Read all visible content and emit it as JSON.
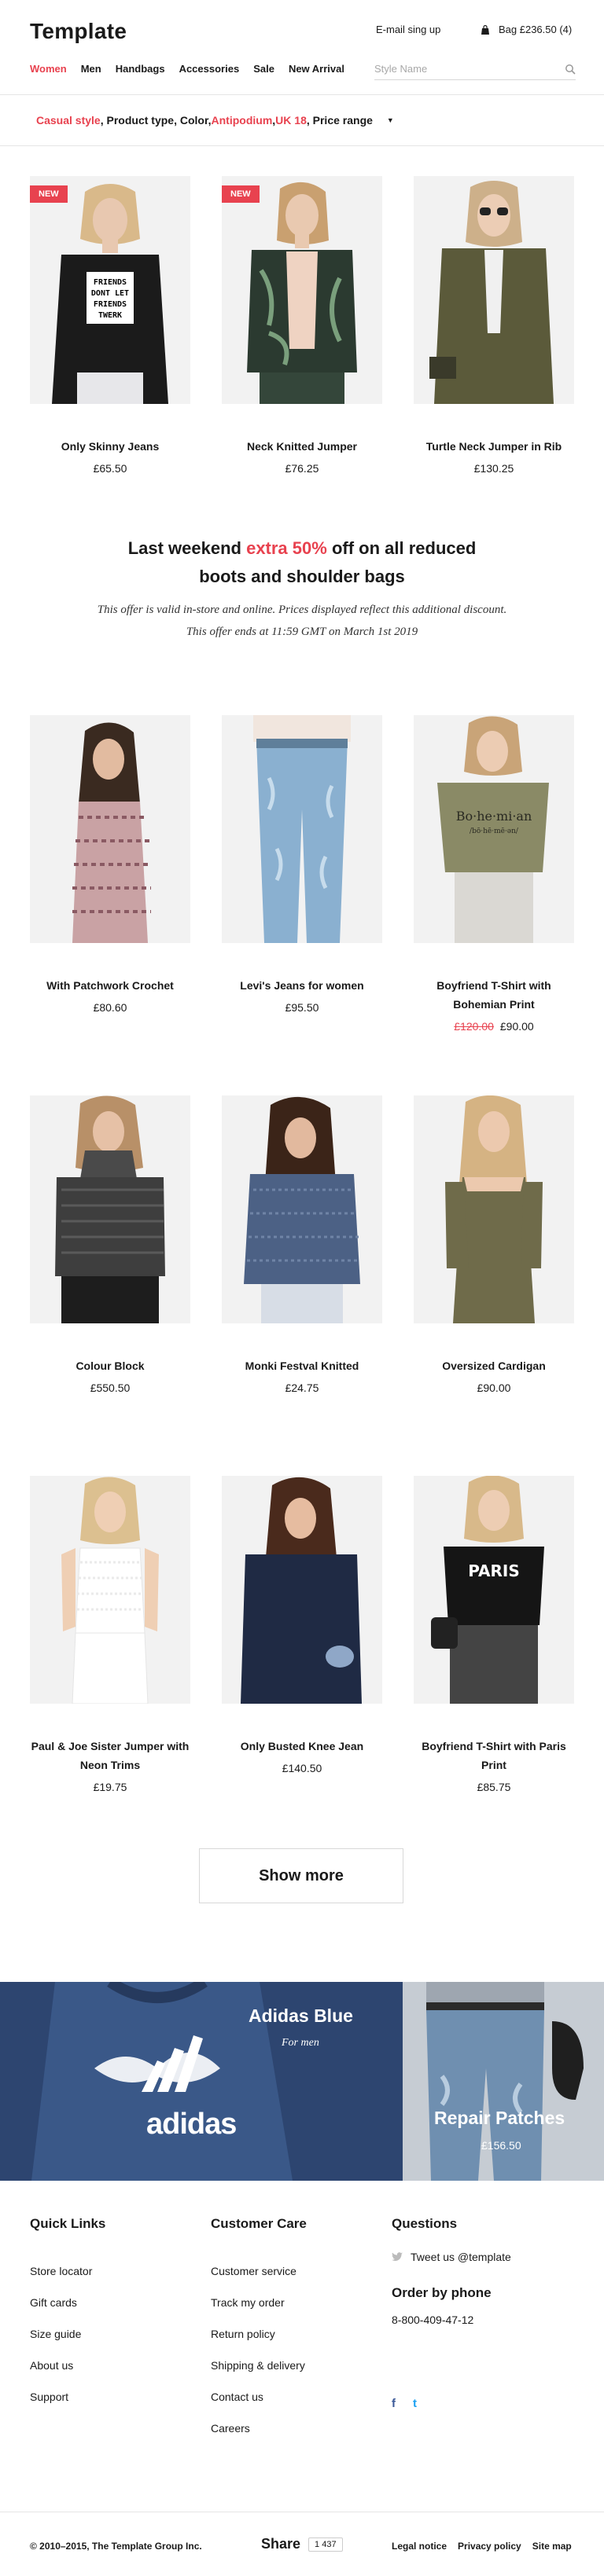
{
  "header": {
    "logo": "Template",
    "signup": "E-mail sing up",
    "bag": "Bag £236.50 (4)",
    "nav": [
      "Women",
      "Men",
      "Handbags",
      "Accessories",
      "Sale",
      "New Arrivals"
    ],
    "search_placeholder": "Style Name"
  },
  "filter": {
    "parts": [
      "Casual style",
      ", Product type, Color, ",
      "Antipodium",
      ", ",
      "UK 18",
      ", Price range"
    ]
  },
  "products_row1": [
    {
      "title": "Only Skinny Jeans",
      "price": "£65.50",
      "badge": "NEW"
    },
    {
      "title": "Neck Knitted Jumper",
      "price": "£76.25",
      "badge": "NEW"
    },
    {
      "title": "Turtle Neck Jumper in Rib",
      "price": "£130.25",
      "badge": ""
    }
  ],
  "promo": {
    "line1_pre": "Last weekend ",
    "line1_hl": "extra 50%",
    "line1_post": " off on all reduced",
    "line2": "boots and shoulder bags",
    "p1": "This offer is valid in-store and online. Prices displayed reflect this additional discount.",
    "p2": "This offer ends at 11:59 GMT on March 1st 2019"
  },
  "products_row2": [
    {
      "title": "With Patchwork Crochet",
      "price": "£80.60"
    },
    {
      "title": "Levi's Jeans for women",
      "price": "£95.50"
    },
    {
      "title": "Boyfriend T-Shirt with Bohemian Print",
      "old_price": "£120.00",
      "price": "£90.00"
    }
  ],
  "products_row3": [
    {
      "title": "Colour Block",
      "price": "£550.50"
    },
    {
      "title": "Monki Festval Knitted",
      "price": "£24.75"
    },
    {
      "title": "Oversized Cardigan",
      "price": "£90.00"
    }
  ],
  "products_row4": [
    {
      "title": "Paul & Joe Sister Jumper with Neon Trims",
      "price": "£19.75"
    },
    {
      "title": "Only Busted Knee Jean",
      "price": "£140.50"
    },
    {
      "title": "Boyfriend T-Shirt with Paris Print",
      "price": "£85.75"
    }
  ],
  "show_more": "Show more",
  "banners": {
    "left": {
      "title": "Adidas Blue",
      "subtitle": "For men",
      "logo": "adidas"
    },
    "right": {
      "title": "Repair Patches",
      "price": "£156.50"
    }
  },
  "footer": {
    "quick_links": {
      "title": "Quick Links",
      "items": [
        "Store locator",
        "Gift cards",
        "Size guide",
        "About us",
        "Support"
      ]
    },
    "customer_care": {
      "title": "Customer Care",
      "items": [
        "Customer service",
        "Track my order",
        "Return policy",
        "Shipping & delivery",
        "Contact us",
        "Careers"
      ]
    },
    "questions": {
      "title": "Questions",
      "twitter": "Tweet us @template",
      "order_title": "Order by phone",
      "phone": "8-800-409-47-12",
      "social": [
        "f",
        "t"
      ]
    },
    "copyright": "© 2010–2015, The Template Group Inc.",
    "share": "Share",
    "share_count": "1 437",
    "legal": [
      "Legal notice",
      "Privacy policy",
      "Site map"
    ]
  },
  "colors": {
    "accent": "#e8424f",
    "banner_blue": "#2d4570",
    "facebook": "#3b5998",
    "twitter": "#1da1f2"
  }
}
